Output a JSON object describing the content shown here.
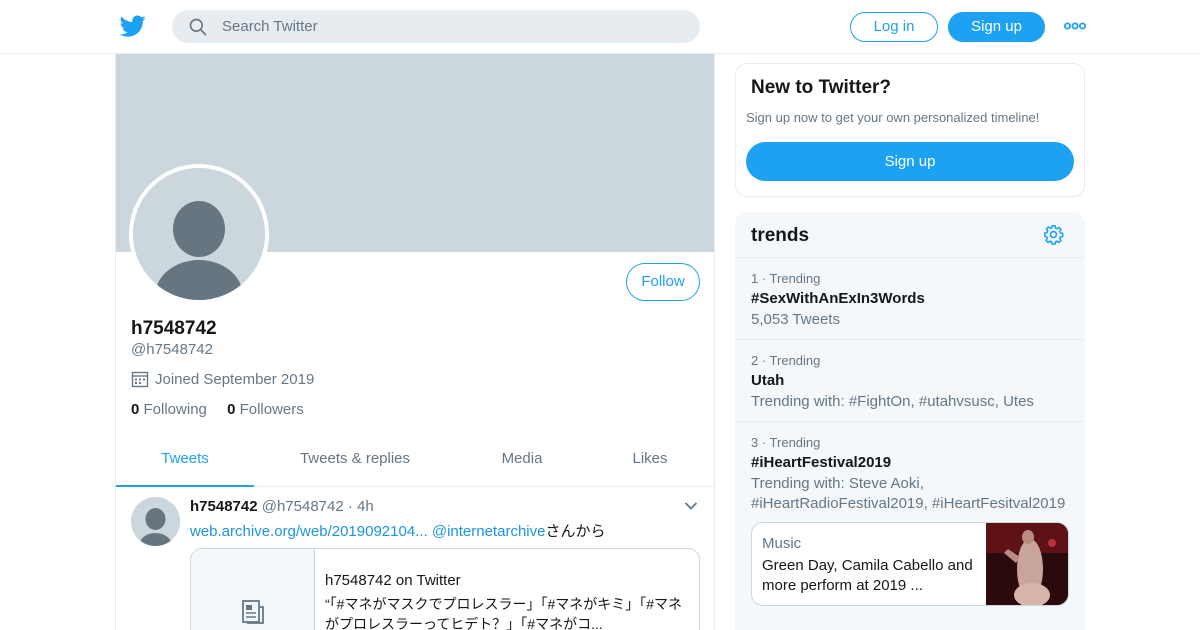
{
  "header": {
    "search_placeholder": "Search Twitter",
    "login_label": "Log in",
    "signup_label": "Sign up"
  },
  "profile": {
    "follow_label": "Follow",
    "display_name": "h7548742",
    "handle": "@h7548742",
    "joined": "Joined September 2019",
    "following_count": "0",
    "following_label": "Following",
    "followers_count": "0",
    "followers_label": "Followers"
  },
  "tabs": [
    {
      "label": "Tweets",
      "active": true
    },
    {
      "label": "Tweets & replies",
      "active": false
    },
    {
      "label": "Media",
      "active": false
    },
    {
      "label": "Likes",
      "active": false
    }
  ],
  "tweet": {
    "author_name": "h7548742",
    "author_handle": "@h7548742",
    "separator": "·",
    "time": "4h",
    "link_text": "web.archive.org/web/2019092104...",
    "mention": "@internetarchive",
    "text_suffix": "さんから",
    "card_title": "h7548742 on Twitter",
    "card_description": "“「#マネがマスクでプロレスラー」「#マネがキミ」「#マネがプロレスラーってヒデト？」「#マネがコ..."
  },
  "new_to_twitter": {
    "title": "New to Twitter?",
    "subtitle": "Sign up now to get your own personalized timeline!",
    "button_label": "Sign up"
  },
  "trends": {
    "title": "trends",
    "items": [
      {
        "meta": "1 · Trending",
        "name": "#SexWithAnExIn3Words",
        "sub": "5,053 Tweets"
      },
      {
        "meta": "2 · Trending",
        "name": "Utah",
        "sub": "Trending with: #FightOn, #utahvsusc, Utes"
      },
      {
        "meta": "3 · Trending",
        "name": "#iHeartFestival2019",
        "sub": "Trending with: Steve Aoki,",
        "sub2": "#iHeartRadioFestival2019, #iHeartFesitval2019"
      }
    ],
    "moment": {
      "category": "Music",
      "title": "Green Day, Camila Cabello and more perform at 2019 ..."
    }
  },
  "colors": {
    "accent": "#1da1f2",
    "banner": "#ccd6dd",
    "secondary_text": "#657786",
    "trends_bg": "#f5f8fa"
  },
  "icons": [
    "twitter-bird-icon",
    "search-icon",
    "more-dots-icon",
    "calendar-icon",
    "chevron-down-icon",
    "document-icon",
    "gear-icon"
  ]
}
